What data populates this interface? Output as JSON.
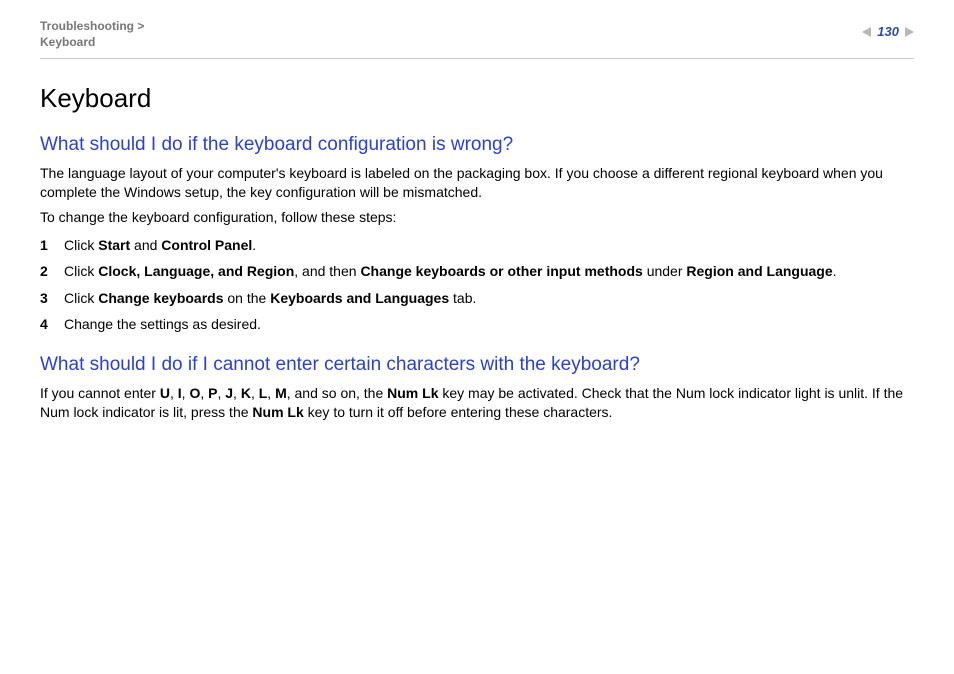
{
  "header": {
    "breadcrumb_parent": "Troubleshooting",
    "breadcrumb_sep": ">",
    "breadcrumb_current": "Keyboard",
    "page_number": "130"
  },
  "title": "Keyboard",
  "section1": {
    "heading": "What should I do if the keyboard configuration is wrong?",
    "p1": "The language layout of your computer's keyboard is labeled on the packaging box. If you choose a different regional keyboard when you complete the Windows setup, the key configuration will be mismatched.",
    "p2": "To change the keyboard configuration, follow these steps:",
    "steps": {
      "n1": "1",
      "s1_a": "Click ",
      "s1_b": "Start",
      "s1_c": " and ",
      "s1_d": "Control Panel",
      "s1_e": ".",
      "n2": "2",
      "s2_a": "Click ",
      "s2_b": "Clock, Language, and Region",
      "s2_c": ", and then ",
      "s2_d": "Change keyboards or other input methods",
      "s2_e": " under ",
      "s2_f": "Region and Language",
      "s2_g": ".",
      "n3": "3",
      "s3_a": "Click ",
      "s3_b": "Change keyboards",
      "s3_c": " on the ",
      "s3_d": "Keyboards and Languages",
      "s3_e": " tab.",
      "n4": "4",
      "s4_a": "Change the settings as desired."
    }
  },
  "section2": {
    "heading": "What should I do if I cannot enter certain characters with the keyboard?",
    "p_a": "If you cannot enter ",
    "k_u": "U",
    "c1": ", ",
    "k_i": "I",
    "c2": ", ",
    "k_o": "O",
    "c3": ", ",
    "k_p": "P",
    "c4": ", ",
    "k_j": "J",
    "c5": ", ",
    "k_k": "K",
    "c6": ", ",
    "k_l": "L",
    "c7": ", ",
    "k_m": "M",
    "p_b": ", and so on, the ",
    "numlk1": "Num Lk",
    "p_c": " key may be activated. Check that the Num lock indicator light is unlit. If the Num lock indicator is lit, press the ",
    "numlk2": "Num Lk",
    "p_d": " key to turn it off before entering these characters."
  }
}
